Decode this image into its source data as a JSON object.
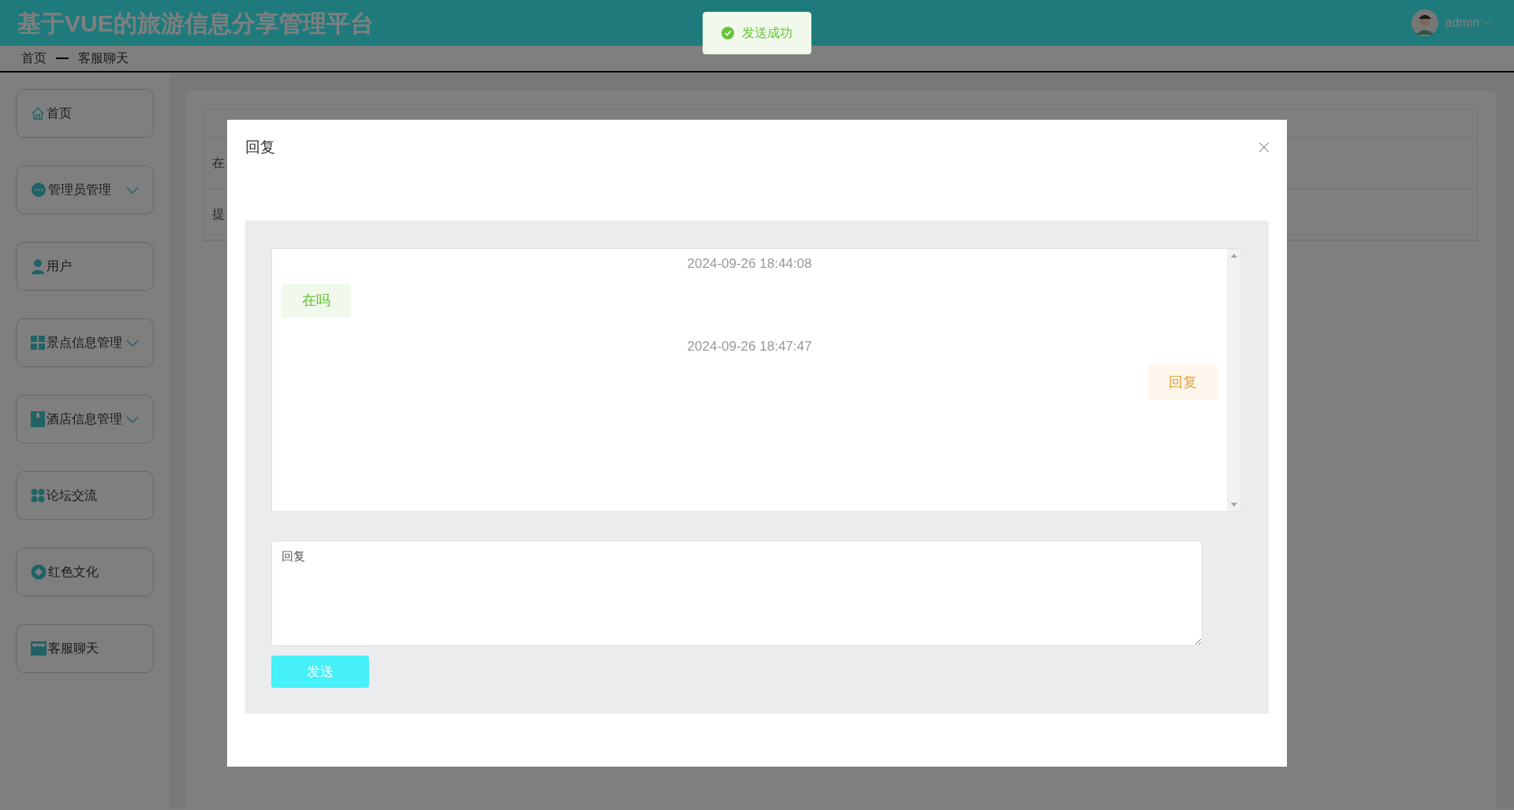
{
  "header": {
    "title": "基于VUE的旅游信息分享管理平台",
    "user": "admin"
  },
  "breadcrumb": [
    "首页",
    "客服聊天"
  ],
  "sidebar": {
    "items": [
      {
        "label": "首页",
        "expandable": false
      },
      {
        "label": "管理员管理",
        "expandable": true
      },
      {
        "label": "用户",
        "expandable": false
      },
      {
        "label": "景点信息管理",
        "expandable": true
      },
      {
        "label": "酒店信息管理",
        "expandable": true
      },
      {
        "label": "论坛交流",
        "expandable": false
      },
      {
        "label": "红色文化",
        "expandable": false
      },
      {
        "label": "客服聊天",
        "expandable": false
      }
    ]
  },
  "table": {
    "rows": [
      [
        "在"
      ],
      [
        "提"
      ]
    ]
  },
  "dialog": {
    "title": "回复",
    "messages": [
      {
        "time": "2024-09-26 18:44:08",
        "text": "在吗",
        "kind": "user"
      },
      {
        "time": "2024-09-26 18:47:47",
        "text": "回复",
        "kind": "admin"
      }
    ],
    "reply": {
      "placeholder": "回复"
    },
    "send_button": "发送"
  },
  "toast": {
    "text": "发送成功",
    "kind": "success"
  }
}
